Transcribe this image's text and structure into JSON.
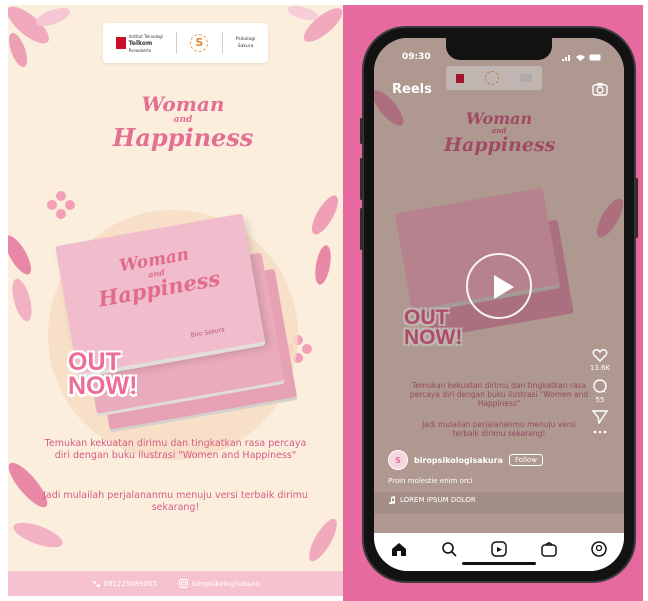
{
  "poster": {
    "logos": {
      "logo1_line1": "Institut Teknologi",
      "logo1_line2": "Telkom",
      "logo1_line3": "Purwokerto",
      "logo2": "S",
      "logo3_line1": "Psikologi",
      "logo3_line2": "Sakura"
    },
    "title_line1": "Woman",
    "title_line2": "and",
    "title_line3": "Happiness",
    "book": {
      "title_line1": "Woman",
      "title_line2": "and",
      "title_line3": "Happiness",
      "author": "Biro Sakura"
    },
    "out_now_line1": "OUT",
    "out_now_line2": "NOW!",
    "text1": "Temukan kekuatan dirimu dan tingkatkan rasa percaya diri dengan buku ilustrasi \"Women and Happiness\"",
    "text2": "Jadi mulailah perjalananmu menuju versi terbaik dirimu sekarang!",
    "footer": {
      "phone": "081225089055",
      "instagram": "biropsikologisakura"
    }
  },
  "phone": {
    "status": {
      "time": "09:30"
    },
    "reels_label": "Reels",
    "reel": {
      "title_line1": "Woman",
      "title_line2": "and",
      "title_line3": "Happiness",
      "out_now_line1": "OUT",
      "out_now_line2": "NOW!",
      "text1": "Temukan kekuatan dirimu dan tingkatkan rasa percaya diri dengan buku ilustrasi \"Women and Happiness\"",
      "text2": "Jadi mulailah perjalananmu menuju versi terbaik dirimu sekarang!"
    },
    "actions": {
      "likes": "13.6K",
      "comments": "55"
    },
    "user": {
      "username": "biropsikologisakura",
      "follow": "Follow",
      "caption": "Proin molestie enim orci",
      "music": "LOREM IPSUM DOLOR"
    },
    "colors": {
      "accent": "#e6699f",
      "poster_bg": "#fbeedd",
      "pink_text": "#e36f93"
    }
  }
}
